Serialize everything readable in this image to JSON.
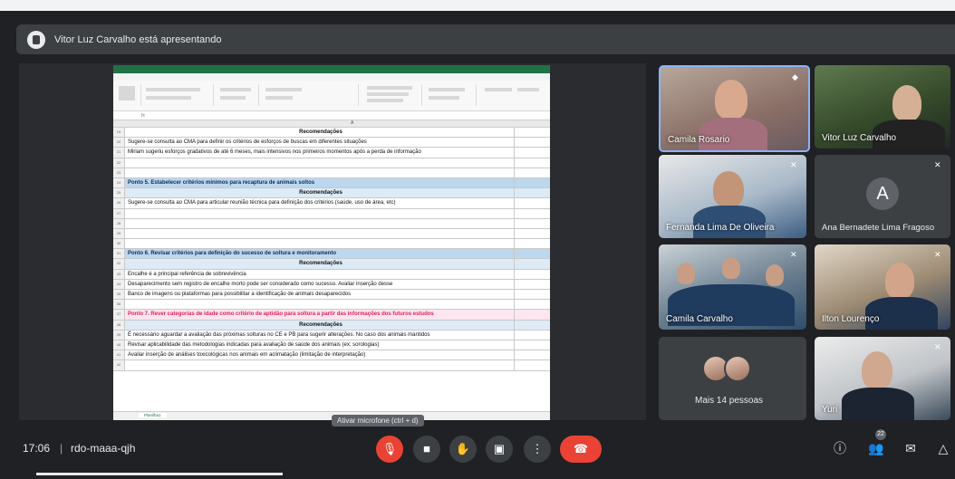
{
  "presenting_banner": "Vitor Luz Carvalho está apresentando",
  "excel": {
    "sheet_tab": "Planilha1",
    "rows": [
      {
        "n": "19",
        "text": "Recomendações",
        "style": "hdr"
      },
      {
        "n": "20",
        "text": "Sugere-se consulta ao CMA para definir os critérios de esforços de buscas em diferentes situações",
        "style": ""
      },
      {
        "n": "21",
        "text": "Miriam sugeriu esforços gradativos de até 6 meses, mais intensivos nos primeiros momentos após a perda de informação",
        "style": ""
      },
      {
        "n": "22",
        "text": "",
        "style": ""
      },
      {
        "n": "23",
        "text": "",
        "style": ""
      },
      {
        "n": "24",
        "text": "Ponto 5. Estabelecer critérios mínimos para recaptura de animais soltos",
        "style": "sec"
      },
      {
        "n": "25",
        "text": "Recomendações",
        "style": "sub"
      },
      {
        "n": "26",
        "text": "Sugere-se consulta ao CMA para articular reunião técnica para definição dos critérios (saúde, uso de área, etc)",
        "style": ""
      },
      {
        "n": "27",
        "text": "",
        "style": ""
      },
      {
        "n": "28",
        "text": "",
        "style": ""
      },
      {
        "n": "29",
        "text": "",
        "style": ""
      },
      {
        "n": "30",
        "text": "",
        "style": ""
      },
      {
        "n": "31",
        "text": "Ponto 6. Revisar critérios para definição do sucesso de soltura e monitoramento",
        "style": "sec"
      },
      {
        "n": "32",
        "text": "Recomendações",
        "style": "sub"
      },
      {
        "n": "33",
        "text": "Encalhe é a principal referência de sobrevivência",
        "style": ""
      },
      {
        "n": "34",
        "text": "Desaparecimento sem registro de encalhe morto pode ser considerado como sucesso. Avaliar inserção desse",
        "style": ""
      },
      {
        "n": "35",
        "text": "Banco de imagens ou plataformas para possibilitar a identificação de animais desaparecidos",
        "style": ""
      },
      {
        "n": "36",
        "text": "",
        "style": ""
      },
      {
        "n": "37",
        "text": "Ponto 7. Rever categorias de idade como critério de aptidão para soltura a partir das informações dos futuros estudos",
        "style": "pink"
      },
      {
        "n": "38",
        "text": "Recomendações",
        "style": "sub"
      },
      {
        "n": "39",
        "text": "É necessário aguardar a avaliação das próximas solturas no CE e PB para sugerir alterações. No caso dos animais mantidos",
        "style": ""
      },
      {
        "n": "40",
        "text": "Revisar aplicabilidade das metodologias indicadas para avaliação de saúde dos animais (ex: sorologias)",
        "style": ""
      },
      {
        "n": "41",
        "text": "Avaliar inserção de análises toxicológicas nos animais em aclimatação (limitação de interpretação)",
        "style": ""
      },
      {
        "n": "42",
        "text": "",
        "style": ""
      }
    ]
  },
  "participants": {
    "p1": "Camila Rosario",
    "p2": "Vitor Luz Carvalho",
    "p3": "Fernanda Lima De Oliveira",
    "p4": "Ana Bernadete Lima Fragoso",
    "p4_initial": "A",
    "p5": "Camila Carvalho",
    "p6": "Ilton Lourenço",
    "p7": "Mais 14 pessoas",
    "p8": "Yuri"
  },
  "tooltip": "Ativar microfone (ctrl + d)",
  "bottom": {
    "time": "17:06",
    "separator": "|",
    "meeting_code": "rdo-maaa-qjh",
    "people_count": "22"
  }
}
